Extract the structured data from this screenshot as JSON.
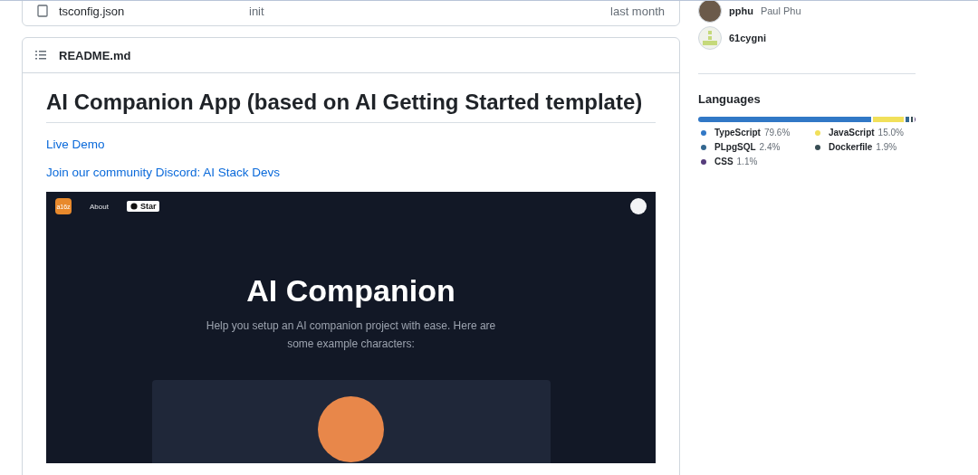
{
  "file_row": {
    "name": "tsconfig.json",
    "commit": "init",
    "date": "last month"
  },
  "readme": {
    "filename": "README.md",
    "title": "AI Companion App (based on AI Getting Started template)",
    "links": [
      "Live Demo",
      "Join our community Discord: AI Stack Devs"
    ],
    "preview": {
      "logo": "a16z",
      "nav": [
        "About"
      ],
      "star": "Star",
      "hero_title": "AI Companion",
      "hero_text": "Help you setup an AI companion project with ease. Here are some example characters:"
    }
  },
  "contributors": [
    {
      "login": "pphu",
      "name": "Paul Phu",
      "kind": "photo"
    },
    {
      "login": "61cygni",
      "kind": "identicon"
    }
  ],
  "languages": {
    "title": "Languages",
    "items": [
      {
        "name": "TypeScript",
        "percent": "79.6%",
        "color": "#3178c6"
      },
      {
        "name": "JavaScript",
        "percent": "15.0%",
        "color": "#f1e05a"
      },
      {
        "name": "PLpgSQL",
        "percent": "2.4%",
        "color": "#336790"
      },
      {
        "name": "Dockerfile",
        "percent": "1.9%",
        "color": "#384d54"
      },
      {
        "name": "CSS",
        "percent": "1.1%",
        "color": "#563d7c"
      }
    ]
  }
}
